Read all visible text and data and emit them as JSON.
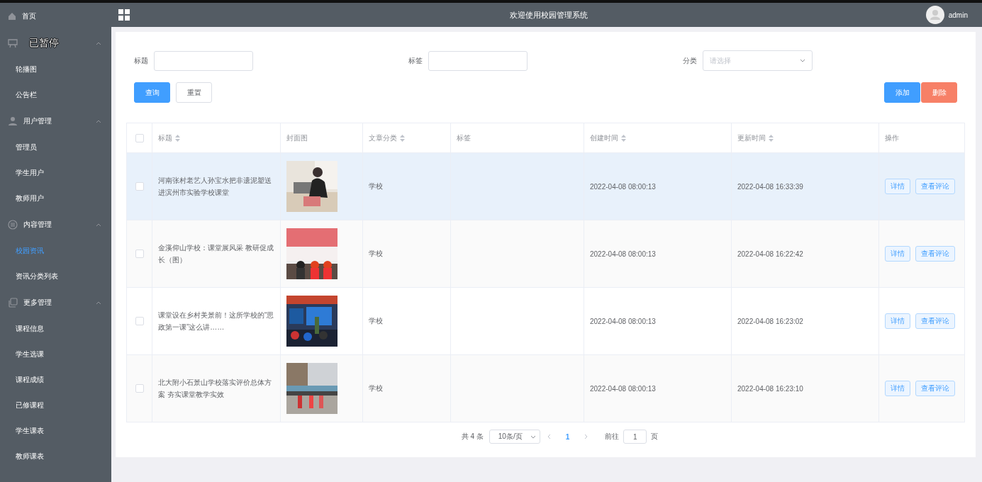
{
  "sidebar": {
    "home": {
      "label": "首页"
    },
    "pause_overlay": "已暂停",
    "groups": [
      {
        "expanded": true,
        "items": [
          {
            "label": "轮播图",
            "selected": false
          },
          {
            "label": "公告栏",
            "selected": false
          }
        ]
      },
      {
        "label": "用户管理",
        "expanded": true,
        "items": [
          {
            "label": "管理员",
            "selected": false
          },
          {
            "label": "学生用户",
            "selected": false
          },
          {
            "label": "教师用户",
            "selected": false
          }
        ]
      },
      {
        "label": "内容管理",
        "expanded": true,
        "items": [
          {
            "label": "校园资讯",
            "selected": true
          },
          {
            "label": "资讯分类列表",
            "selected": false
          }
        ]
      },
      {
        "label": "更多管理",
        "expanded": true,
        "items": [
          {
            "label": "课程信息",
            "selected": false
          },
          {
            "label": "学生选课",
            "selected": false
          },
          {
            "label": "课程成绩",
            "selected": false
          },
          {
            "label": "已修课程",
            "selected": false
          },
          {
            "label": "学生课表",
            "selected": false
          },
          {
            "label": "教师课表",
            "selected": false
          }
        ]
      }
    ]
  },
  "header": {
    "title": "欢迎使用校园管理系统",
    "user": "admin"
  },
  "search": {
    "fields": [
      {
        "kind": "text",
        "label": "标题"
      },
      {
        "kind": "text",
        "label": "标签"
      },
      {
        "kind": "select",
        "label": "分类",
        "placeholder": "请选择"
      }
    ],
    "left_buttons": [
      {
        "label": "查询",
        "kind": "primary"
      },
      {
        "label": "重置",
        "kind": "plain"
      }
    ],
    "right_buttons": [
      {
        "label": "添加",
        "kind": "primary"
      },
      {
        "label": "删除",
        "kind": "danger"
      }
    ]
  },
  "table": {
    "columns": [
      {
        "label": "标题",
        "sortable": true
      },
      {
        "label": "封面图",
        "sortable": false
      },
      {
        "label": "文章分类",
        "sortable": true
      },
      {
        "label": "标签",
        "sortable": false
      },
      {
        "label": "创建时间",
        "sortable": true
      },
      {
        "label": "更新时间",
        "sortable": true
      },
      {
        "label": "操作",
        "sortable": false
      }
    ],
    "header_checked": false,
    "rows": [
      {
        "checked": false,
        "highlighted": true,
        "title": "河南张村老艺人孙宝水把非遗泥塑送进滨州市实验学校课堂",
        "cover": {
          "kind": "picture"
        },
        "category": "学校",
        "created": "2022-04-08 08:00:13",
        "updated": "2022-04-08 16:33:39",
        "actions": [
          "详情",
          "查看评论"
        ]
      },
      {
        "checked": false,
        "highlighted": false,
        "title": "金溪仰山学校：课堂展风采 教研促成长（图）",
        "cover": {
          "kind": "picture"
        },
        "category": "学校",
        "created": "2022-04-08 08:00:13",
        "updated": "2022-04-08 16:22:42",
        "actions": [
          "详情",
          "查看评论"
        ]
      },
      {
        "checked": false,
        "highlighted": false,
        "title": "课堂设在乡村美景前！这所学校的“思政第一课”这么讲……",
        "cover": {
          "kind": "picture"
        },
        "category": "学校",
        "created": "2022-04-08 08:00:13",
        "updated": "2022-04-08 16:23:02",
        "actions": [
          "详情",
          "查看评论"
        ]
      },
      {
        "checked": false,
        "highlighted": false,
        "title": "北大附小石景山学校落实评价总体方案 夯实课堂教学实效",
        "cover": {
          "kind": "picture"
        },
        "category": "学校",
        "created": "2022-04-08 08:00:13",
        "updated": "2022-04-08 16:23:10",
        "actions": [
          "详情",
          "查看评论"
        ]
      }
    ]
  },
  "pagination": {
    "total": "共 4 条",
    "page_size": "10条/页",
    "pages": [
      {
        "label": "1",
        "selected": true
      }
    ],
    "goto_label": "前往",
    "goto_value": "1",
    "goto_suffix": "页"
  }
}
